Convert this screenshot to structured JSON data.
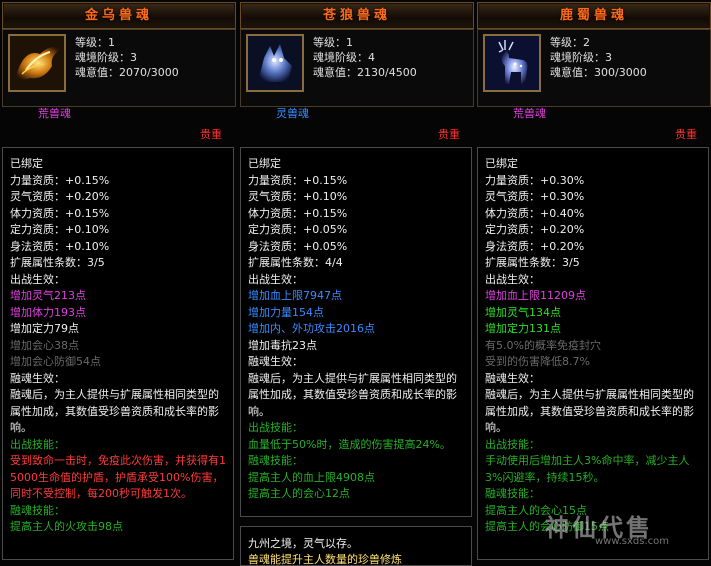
{
  "labels": {
    "level": "等级：",
    "tier": "魂境阶级：",
    "will": "魂意值："
  },
  "panels": [
    {
      "title": "金乌兽魂",
      "level": "1",
      "tier": "3",
      "will": "2070/3000",
      "soul_type": "荒兽魂",
      "soul_type_color": "#e040e0",
      "rarity": "贵重",
      "icon": "golden-crow-phoenix-icon",
      "lines": [
        {
          "t": "已绑定",
          "c": "w"
        },
        {
          "t": "力量资质：+0.15%",
          "c": "w"
        },
        {
          "t": "灵气资质：+0.20%",
          "c": "w"
        },
        {
          "t": "体力资质：+0.15%",
          "c": "w"
        },
        {
          "t": "定力资质：+0.10%",
          "c": "w"
        },
        {
          "t": "身法资质：+0.10%",
          "c": "w"
        },
        {
          "t": "扩展属性条数：3/5",
          "c": "w"
        },
        {
          "t": "出战生效：",
          "c": "w"
        },
        {
          "t": "增加灵气213点",
          "c": "pu"
        },
        {
          "t": "增加体力193点",
          "c": "pu"
        },
        {
          "t": "增加定力79点",
          "c": "w"
        },
        {
          "t": "增加会心38点",
          "c": "gy"
        },
        {
          "t": "增加会心防御54点",
          "c": "gy"
        },
        {
          "t": "融魂生效：",
          "c": "w"
        },
        {
          "t": "融魂后，为主人提供与扩展属性相同类型的属性加成，其数值受珍兽资质和成长率的影响。",
          "c": "w",
          "wrap": true
        },
        {
          "t": "出战技能：",
          "c": "dg"
        },
        {
          "t": "受到致命一击时，免疫此次伤害，并获得有15000生命值的护盾，护盾承受100%伤害，同时不受控制，每200秒可触发1次。",
          "c": "rd",
          "wrap": true
        },
        {
          "t": "融魂技能：",
          "c": "dg"
        },
        {
          "t": "提高主人的火攻击98点",
          "c": "dg"
        }
      ]
    },
    {
      "title": "苍狼兽魂",
      "level": "1",
      "tier": "4",
      "will": "2130/4500",
      "soul_type": "灵兽魂",
      "soul_type_color": "#3a8cff",
      "rarity": "贵重",
      "icon": "azure-wolf-icon",
      "lines": [
        {
          "t": "已绑定",
          "c": "w"
        },
        {
          "t": "力量资质：+0.15%",
          "c": "w"
        },
        {
          "t": "灵气资质：+0.10%",
          "c": "w"
        },
        {
          "t": "体力资质：+0.15%",
          "c": "w"
        },
        {
          "t": "定力资质：+0.05%",
          "c": "w"
        },
        {
          "t": "身法资质：+0.05%",
          "c": "w"
        },
        {
          "t": "扩展属性条数：4/4",
          "c": "w"
        },
        {
          "t": "出战生效：",
          "c": "w"
        },
        {
          "t": "增加血上限7947点",
          "c": "bl"
        },
        {
          "t": "增加力量154点",
          "c": "bl"
        },
        {
          "t": "增加内、外功攻击2016点",
          "c": "bl"
        },
        {
          "t": "增加毒抗23点",
          "c": "w"
        },
        {
          "t": "融魂生效：",
          "c": "w"
        },
        {
          "t": "融魂后，为主人提供与扩展属性相同类型的属性加成，其数值受珍兽资质和成长率的影响。",
          "c": "w",
          "wrap": true
        },
        {
          "t": "出战技能：",
          "c": "dg"
        },
        {
          "t": "血量低于50%时，造成的伤害提高24%。",
          "c": "dg"
        },
        {
          "t": "融魂技能：",
          "c": "dg"
        },
        {
          "t": "提高主人的血上限4908点",
          "c": "dg"
        },
        {
          "t": "提高主人的会心12点",
          "c": "dg"
        }
      ],
      "tip": "九州之境，灵气以存。",
      "tip2": "兽魂能提升主人数量的珍兽修炼"
    },
    {
      "title": "鹿蜀兽魂",
      "level": "2",
      "tier": "3",
      "will": "300/3000",
      "soul_type": "荒兽魂",
      "soul_type_color": "#e040e0",
      "rarity": "贵重",
      "icon": "luzhu-deer-icon",
      "lines": [
        {
          "t": "已绑定",
          "c": "w"
        },
        {
          "t": "力量资质：+0.30%",
          "c": "w"
        },
        {
          "t": "灵气资质：+0.30%",
          "c": "w"
        },
        {
          "t": "体力资质：+0.40%",
          "c": "w"
        },
        {
          "t": "定力资质：+0.20%",
          "c": "w"
        },
        {
          "t": "身法资质：+0.20%",
          "c": "w"
        },
        {
          "t": "扩展属性条数：3/5",
          "c": "w"
        },
        {
          "t": "出战生效：",
          "c": "w"
        },
        {
          "t": "增加血上限11209点",
          "c": "pu"
        },
        {
          "t": "增加灵气134点",
          "c": "gn"
        },
        {
          "t": "增加定力131点",
          "c": "gn"
        },
        {
          "t": "有5.0%的概率免疫封穴",
          "c": "gy"
        },
        {
          "t": "受到的伤害降低8.7%",
          "c": "gy"
        },
        {
          "t": "融魂生效：",
          "c": "w"
        },
        {
          "t": "融魂后，为主人提供与扩展属性相同类型的属性加成，其数值受珍兽资质和成长率的影响。",
          "c": "w",
          "wrap": true
        },
        {
          "t": "出战技能：",
          "c": "dg"
        },
        {
          "t": "手动使用后增加主人3%命中率，减少主人3%闪避率，持续15秒。",
          "c": "dg",
          "wrap": true
        },
        {
          "t": "融魂技能：",
          "c": "dg"
        },
        {
          "t": "提高主人的会心15点",
          "c": "dg"
        },
        {
          "t": "提高主人的会心防御15点",
          "c": "dg"
        }
      ]
    }
  ],
  "watermark": {
    "text": "神仙代售",
    "url": "www.sxds.com"
  }
}
